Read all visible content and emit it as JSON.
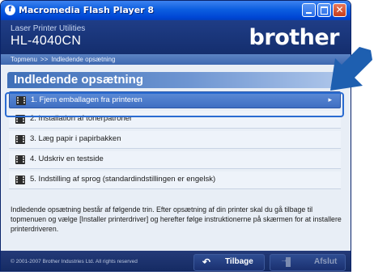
{
  "window": {
    "title": "Macromedia Flash Player 8",
    "app_icon": "flash-icon"
  },
  "header": {
    "subtitle": "Laser Printer Utilities",
    "model": "HL-4040CN",
    "logo": "brother"
  },
  "breadcrumb": {
    "home": "Topmenu",
    "separator": ">>",
    "current": "Indledende opsætning"
  },
  "section": {
    "heading": "Indledende opsætning"
  },
  "menu": {
    "items": [
      {
        "label": "1. Fjern emballagen fra printeren",
        "icon": "film-icon",
        "active": true
      },
      {
        "label": "2. Installation af tonerpatroner",
        "icon": "film-icon"
      },
      {
        "label": "3. Læg papir i papirbakken",
        "icon": "film-icon"
      },
      {
        "label": "4. Udskriv en testside",
        "icon": "film-icon"
      },
      {
        "label": "5. Indstilling af sprog (standardindstillingen er engelsk)",
        "icon": "film-icon"
      }
    ]
  },
  "description": "Indledende opsætning består af følgende trin. Efter opsætning af din printer skal du gå tilbage til topmenuen og vælge [Installer printerdriver] og herefter følge instruktionerne på skærmen for at installere printerdriveren.",
  "footer": {
    "copyright": "© 2001-2007 Brother Industries  Ltd. All rights reserved",
    "back_label": "Tilbage",
    "exit_label": "Afslut"
  },
  "colors": {
    "header_bg": "#1f3d86",
    "accent": "#2a6bd1",
    "active_item": "#4a7bcc",
    "pointer_arrow": "#1e5fb0"
  }
}
